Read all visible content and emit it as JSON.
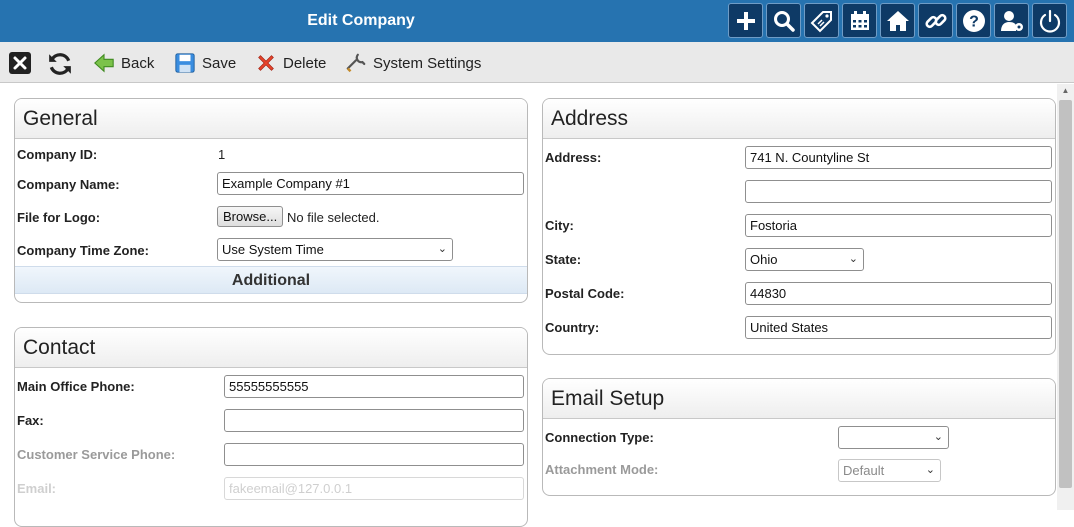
{
  "header": {
    "title": "Edit Company",
    "icons": [
      "plus-icon",
      "search-icon",
      "tag-icon",
      "calendar-icon",
      "home-icon",
      "link-icon",
      "help-icon",
      "user-settings-icon",
      "power-icon"
    ]
  },
  "toolbar": {
    "close_icon": "close-icon",
    "refresh_icon": "refresh-icon",
    "back_label": "Back",
    "save_label": "Save",
    "delete_label": "Delete",
    "system_settings_label": "System Settings"
  },
  "general": {
    "title": "General",
    "company_id_label": "Company ID:",
    "company_id_value": "1",
    "company_name_label": "Company Name:",
    "company_name_value": "Example Company #1",
    "logo_label": "File for Logo:",
    "browse_label": "Browse...",
    "no_file_text": "No file selected.",
    "timezone_label": "Company Time Zone:",
    "timezone_value": "Use System Time",
    "additional_label": "Additional"
  },
  "contact": {
    "title": "Contact",
    "main_phone_label": "Main Office Phone:",
    "main_phone_value": "55555555555",
    "fax_label": "Fax:",
    "fax_value": "",
    "cs_phone_label": "Customer Service Phone:",
    "cs_phone_value": "",
    "email_label": "Email:",
    "email_value": "fakeemail@127.0.0.1"
  },
  "address": {
    "title": "Address",
    "address_label": "Address:",
    "address_line1": "741 N. Countyline St",
    "address_line2": "",
    "city_label": "City:",
    "city_value": "Fostoria",
    "state_label": "State:",
    "state_value": "Ohio",
    "postal_label": "Postal Code:",
    "postal_value": "44830",
    "country_label": "Country:",
    "country_value": "United States"
  },
  "email_setup": {
    "title": "Email Setup",
    "connection_type_label": "Connection Type:",
    "connection_type_value": "",
    "attachment_mode_label": "Attachment Mode:",
    "attachment_mode_value": "Default"
  },
  "colors": {
    "header_bg": "#2673b0",
    "icon_button_bg": "#0e3a66",
    "toolbar_bg": "#e9e9e9"
  }
}
